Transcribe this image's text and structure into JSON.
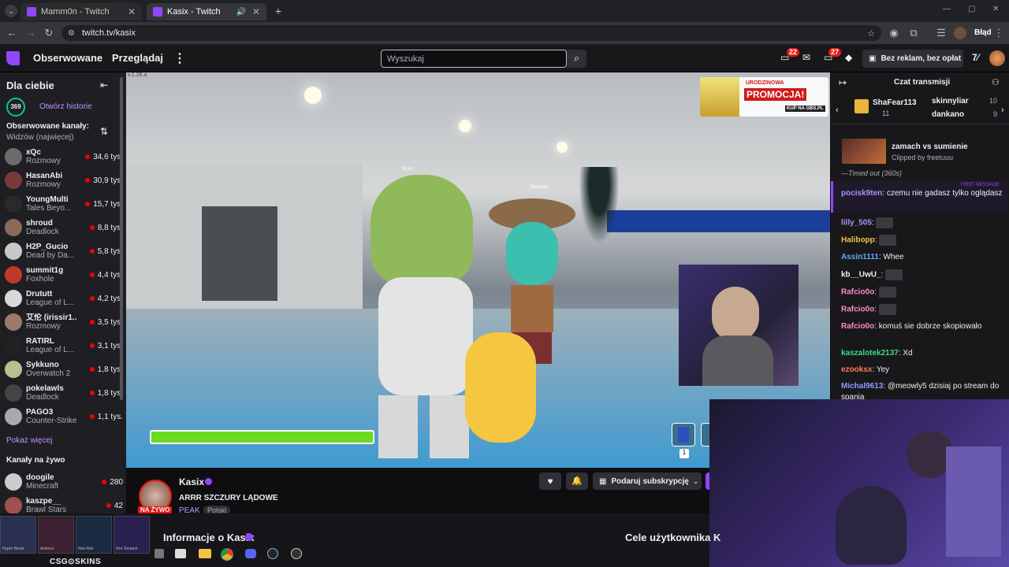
{
  "browser": {
    "tabs": [
      {
        "title": "Mamm0n - Twitch"
      },
      {
        "title": "Kasix - Twitch"
      }
    ],
    "url": "twitch.tv/kasix",
    "profile_label": "Błąd"
  },
  "header": {
    "nav": [
      "Obserwowane",
      "Przeglądaj"
    ],
    "search_placeholder": "Wyszukaj",
    "notif_count_1": "22",
    "notif_count_2": "27",
    "promo_label": "Bez reklam, bez opłat"
  },
  "sidebar": {
    "title": "Dla ciebie",
    "stories_count": "369",
    "stories_label": "Otwórz historie",
    "followed_title": "Obserwowane kanały:",
    "followed_sort": "Widzów (najwięcej)",
    "channels": [
      {
        "name": "xQc",
        "game": "Rozmowy",
        "viewers": "34,6 tys.",
        "color": "#6b6b6b"
      },
      {
        "name": "HasanAbi",
        "game": "Rozmowy",
        "viewers": "30,9 tys.",
        "color": "#7a3a3a"
      },
      {
        "name": "YoungMulti",
        "game": "Tales Beyo...",
        "viewers": "15,7 tys.",
        "color": "#2a2a2a"
      },
      {
        "name": "shroud",
        "game": "Deadlock",
        "viewers": "8,8 tys.",
        "color": "#8a6a5a"
      },
      {
        "name": "H2P_Gucio",
        "game": "Dead by Da...",
        "viewers": "5,8 tys.",
        "color": "#c8c8c8"
      },
      {
        "name": "summit1g",
        "game": "Foxhole",
        "viewers": "4,4 tys.",
        "color": "#c0392b"
      },
      {
        "name": "Drututt",
        "game": "League of L...",
        "viewers": "4,2 tys.",
        "color": "#d8d8d8"
      },
      {
        "name": "艾伦 (irissir1...",
        "game": "Rozmowy",
        "viewers": "3,5 tys.",
        "color": "#9a7a6a"
      },
      {
        "name": "RATIRL",
        "game": "League of L...",
        "viewers": "3,1 tys.",
        "color": "#222"
      },
      {
        "name": "Sykkuno",
        "game": "Overwatch 2",
        "viewers": "1,8 tys.",
        "color": "#b8c090"
      },
      {
        "name": "pokelawls",
        "game": "Deadlock",
        "viewers": "1,8 tys.",
        "color": "#444"
      },
      {
        "name": "PAGO3",
        "game": "Counter-Strike",
        "viewers": "1,1 tys.",
        "color": "#aaa"
      }
    ],
    "show_more": "Pokaż więcej",
    "live_title": "Kanały na żywo",
    "live_channels": [
      {
        "name": "doogile",
        "game": "Minecraft",
        "viewers": "280",
        "color": "#ccc"
      },
      {
        "name": "kaszpe__",
        "game": "Brawl Stars",
        "viewers": "42",
        "color": "#a05050"
      }
    ]
  },
  "video": {
    "version": "v.1.26.a",
    "promo_top": "URODZINOWA",
    "promo_main": "PROMOCJA!",
    "promo_url": "KUP NA GBS.PL",
    "health_fill": 1.0,
    "slot_count": "1",
    "player_tag_1": "Brasi",
    "player_tag_2": "Zwierzak"
  },
  "stream": {
    "channel": "Kasix",
    "title": "ARRR SZCZURY LĄDOWE",
    "live": "NA ŻYWO",
    "game": "PEAK",
    "language": "Polski",
    "gift_sub": "Podaruj subskrypcję",
    "about": "Informacje o Kasix",
    "goals": "Cele użytkownika K"
  },
  "chat": {
    "title": "Czat transmisji",
    "gifters": [
      {
        "name": "ShaFear113",
        "count": "11"
      },
      {
        "name": "skinnyliar",
        "count": "10"
      },
      {
        "name": "dankano",
        "count": "9"
      }
    ],
    "clip_title": "zamach vs sumienie",
    "clip_by": "Clipped by freetuuu",
    "timeout": "—Timed out (360s)",
    "first_msg_label": "FIRST MESSAGE",
    "messages": [
      {
        "user": "pocisk9ten",
        "text": "czemu nie gadasz tylko oglądasz",
        "color": "#b18cff"
      },
      {
        "user": "lilly_505",
        "text": "",
        "color": "#b18cff"
      },
      {
        "user": "Halibopp",
        "text": "",
        "color": "#f0c040"
      },
      {
        "user": "Assin1111",
        "text": "Whee",
        "color": "#5fa8ff"
      },
      {
        "user": "kb__UwU_",
        "text": "",
        "color": "#efeff1"
      },
      {
        "user": "Rafcio0o",
        "text": "",
        "color": "#ff8bc8"
      },
      {
        "user": "Rafcio0o",
        "text": "",
        "color": "#ff8bc8"
      },
      {
        "user": "Rafcio0o",
        "text": "komuś sie dobrze skopiowało",
        "color": "#ff8bc8"
      },
      {
        "user": "kaszalotek2137",
        "text": "Xd",
        "color": "#3ddc84"
      },
      {
        "user": "ezooksx",
        "text": "Yey",
        "color": "#ff7a59"
      },
      {
        "user": "Michal9613",
        "text": "@meowly5 dzisiaj po stream do spania",
        "color": "#8b9cff"
      }
    ]
  },
  "taskbar": {
    "ad_brand": "CSG⊙SKINS",
    "skins": [
      "Hyper Beast",
      "Asiimov",
      "Neo-Noir",
      "Fire Serpent"
    ],
    "icons": [
      "explorer-icon",
      "chrome-icon",
      "discord-icon",
      "steam-icon",
      "obs-icon"
    ]
  }
}
